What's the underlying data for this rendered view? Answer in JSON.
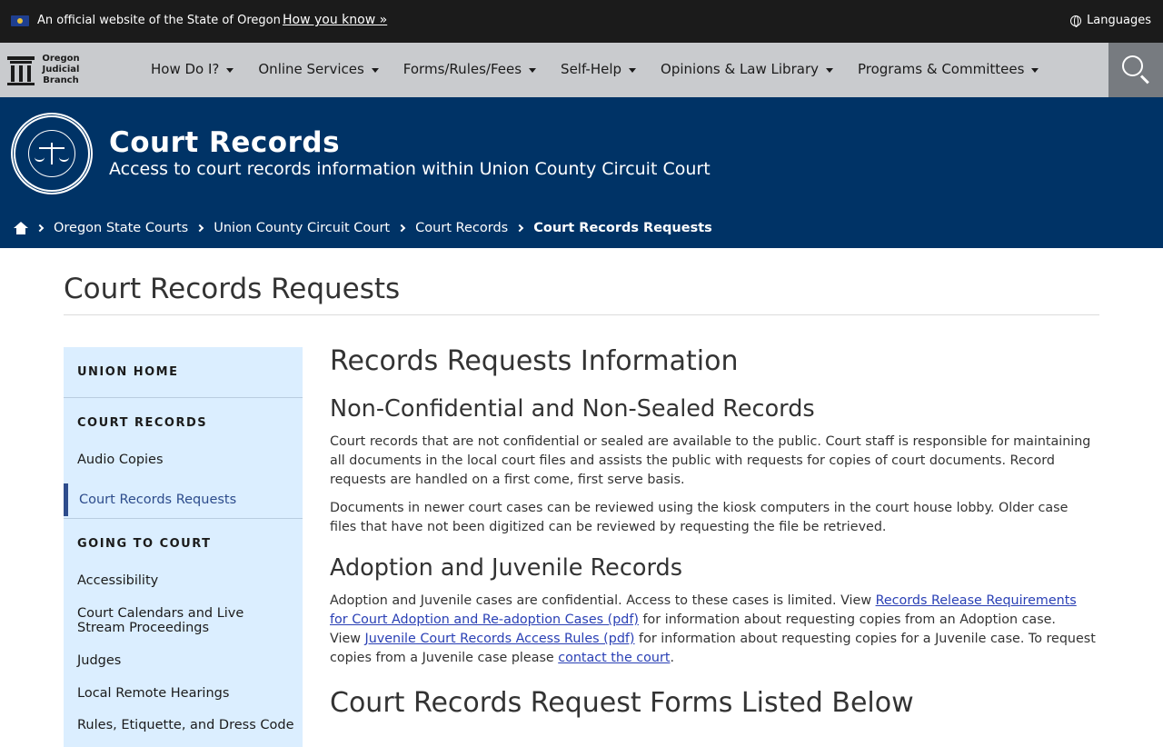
{
  "banner": {
    "official_text": "An official website of the State of Oregon",
    "how_you_know": "How you know »",
    "languages": "Languages"
  },
  "logo": {
    "line1": "Oregon",
    "line2": "Judicial",
    "line3": "Branch"
  },
  "nav": {
    "items": [
      {
        "label": "How Do I?"
      },
      {
        "label": "Online Services"
      },
      {
        "label": "Forms/Rules/Fees"
      },
      {
        "label": "Self-Help"
      },
      {
        "label": "Opinions & Law Library"
      },
      {
        "label": "Programs & Committees"
      }
    ]
  },
  "hero": {
    "title": "Court Records",
    "subtitle": "Access to court records information within Union County Circuit Court",
    "breadcrumb": [
      {
        "label": "Oregon State Courts"
      },
      {
        "label": "Union County Circuit Court"
      },
      {
        "label": "Court Records"
      },
      {
        "label": "Court Records Requests"
      }
    ]
  },
  "page_title": "Court Records Requests",
  "sidebar": {
    "union_home": "UNION HOME",
    "court_records_head": "COURT RECORDS",
    "audio_copies": "Audio Copies",
    "active_item": "Court Records Requests",
    "going_to_court_head": "GOING TO COURT",
    "links": [
      {
        "label": "Accessibility"
      },
      {
        "label": "Court Calendars and Live Stream Proceedings"
      },
      {
        "label": "Judges"
      },
      {
        "label": "Local Remote Hearings"
      },
      {
        "label": "Rules, Etiquette, and Dress Code"
      }
    ]
  },
  "main": {
    "heading": "Records Requests Information",
    "section1": {
      "title": "Non-Confidential and Non-Sealed Records",
      "para1": "Court records that are not confidential or sealed are available to the public. Court staff is responsible for maintaining all documents in the local court files and assists the public with requests for copies of court documents. Record requests are handled on a first come, first serve basis.",
      "para2": "Documents in newer court cases can be reviewed using the kiosk computers in the court house lobby. Older case files that have not been digitized can be reviewed by requesting the file be retrieved."
    },
    "section2": {
      "title": "Adoption and Juvenile Records",
      "text1": "Adoption and Juvenile cases are confidential. Access to these cases is limited. View ",
      "link1": "Records Release Requirements for Court Adoption and Re-adoption Cases (pdf)",
      "text2": " for information about requesting copies from an Adoption case.",
      "text3": "View ",
      "link2": "Juvenile Court Records Access Rules (pdf)",
      "text4": " for information about requesting copies for a Juvenile case. To request copies from a Juvenile case please ",
      "link3": "contact the court",
      "text5": "."
    },
    "section3": {
      "title": "Court Records Request Forms Listed Below"
    }
  },
  "colors": {
    "banner_bg": "#1b1b1b",
    "nav_bg": "#c9cbce",
    "hero_bg": "#003366",
    "sidebar_bg": "#dbeeff",
    "link": "#2a40b5",
    "active_accent": "#2d4c8c"
  }
}
